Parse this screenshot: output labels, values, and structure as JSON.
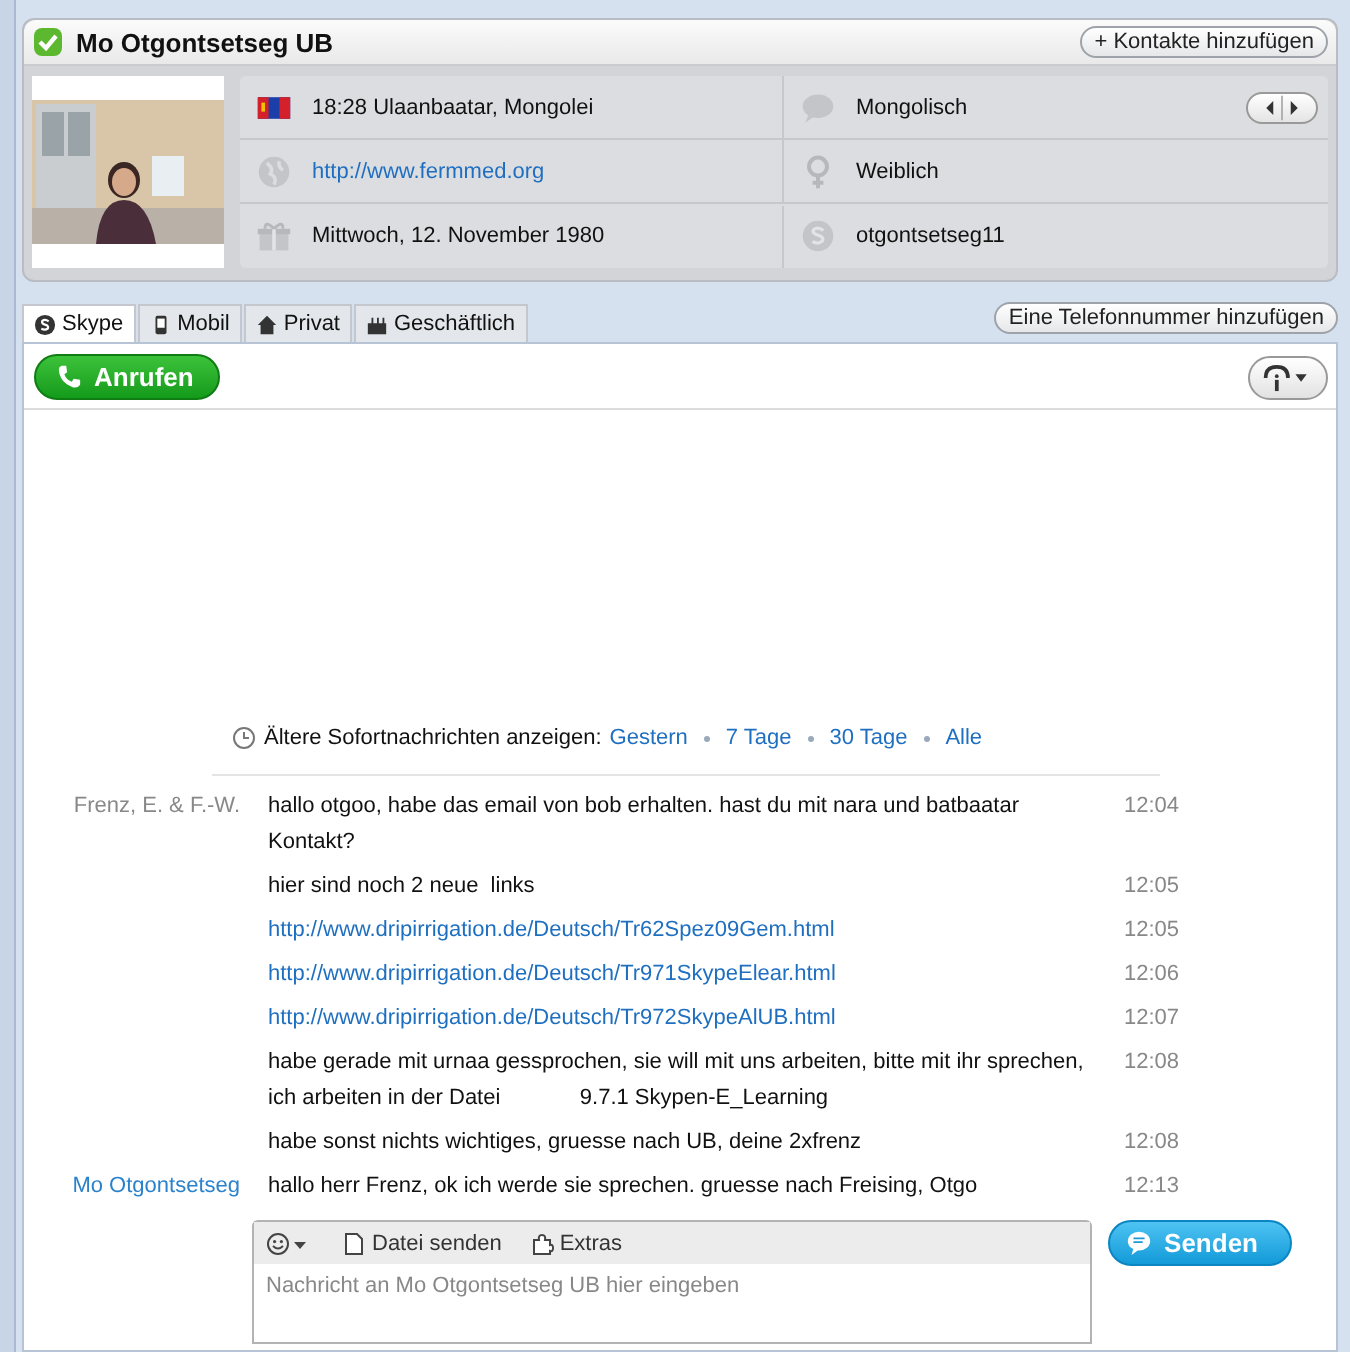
{
  "contact": {
    "name": "Mo Otgontsetseg UB",
    "online": true,
    "add_button": "+ Kontakte hinzufügen"
  },
  "profile": {
    "fields": [
      {
        "text": "18:28 Ulaanbaatar, Mongolei",
        "link": false
      },
      {
        "text": "Mongolisch",
        "link": false,
        "arrows": true
      },
      {
        "text": "http://www.fermmed.org",
        "link": true
      },
      {
        "text": "Weiblich",
        "link": false
      },
      {
        "text": "Mittwoch, 12. November 1980",
        "link": false
      },
      {
        "text": "otgontsetseg11",
        "link": false
      }
    ]
  },
  "tabs": [
    {
      "label": "Skype",
      "selected": true
    },
    {
      "label": "Mobil",
      "selected": false
    },
    {
      "label": "Privat",
      "selected": false
    },
    {
      "label": "Geschäftlich",
      "selected": false
    }
  ],
  "add_phone_button": "Eine Telefonnummer hinzufügen",
  "call_button": "Anrufen",
  "history": {
    "label": "Ältere Sofortnachrichten anzeigen:",
    "links": [
      "Gestern",
      "7 Tage",
      "30 Tage",
      "Alle"
    ]
  },
  "messages": [
    {
      "sender": "Frenz, E. & F.-W.",
      "own": false,
      "kind": "text",
      "text": "hallo otgoo, habe das email von bob erhalten. hast du mit nara und batbaatar Kontakt?",
      "time": "12:04"
    },
    {
      "kind": "text",
      "text": "hier sind noch 2 neue  links",
      "time": "12:05"
    },
    {
      "kind": "link",
      "text": "http://www.dripirrigation.de/Deutsch/Tr62Spez09Gem.html",
      "time": "12:05"
    },
    {
      "kind": "link",
      "text": "http://www.dripirrigation.de/Deutsch/Tr971SkypeElear.html",
      "time": "12:06"
    },
    {
      "kind": "link",
      "text": "http://www.dripirrigation.de/Deutsch/Tr972SkypeAlUB.html",
      "time": "12:07"
    },
    {
      "kind": "text",
      "text": "habe gerade mit urnaa gessprochen, sie will mit uns arbeiten, bitte mit ihr sprechen, ich arbeiten in der Datei             9.7.1 Skypen-E_Learning",
      "time": "12:08"
    },
    {
      "kind": "text",
      "text": "habe sonst nichts wichtiges, gruesse nach UB, deine 2xfrenz",
      "time": "12:08"
    },
    {
      "sender": "Mo Otgontsetseg",
      "own": true,
      "kind": "text",
      "text": "hallo herr Frenz, ok ich werde sie sprechen. gruesse nach Freising, Otgo",
      "time": "12:13"
    }
  ],
  "composer": {
    "tools": [
      "Datei senden",
      "Extras"
    ],
    "placeholder": "Nachricht an Mo Otgontsetseg UB hier eingeben",
    "send_button": "Senden"
  }
}
